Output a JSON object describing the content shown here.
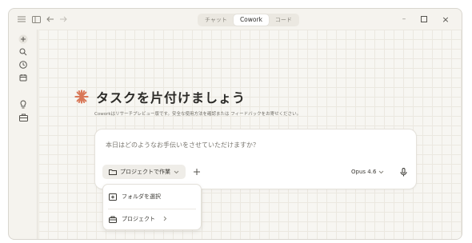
{
  "titlebar": {
    "tabs": [
      {
        "label": "チャット",
        "active": false
      },
      {
        "label": "Cowork",
        "active": true
      },
      {
        "label": "コード",
        "active": false
      }
    ],
    "minimize": "–",
    "maximize": "□",
    "close": "×"
  },
  "sidebar": {
    "icons": [
      "plus-icon",
      "search-icon",
      "clock-icon",
      "calendar-icon",
      "lightbulb-icon",
      "briefcase-icon"
    ]
  },
  "main": {
    "title": "タスクを片付けましょう",
    "subtitle": "Coworkはリサーチプレビュー版です。安全な使用方法を確認または フィードバックをお寄せください。",
    "accent_color": "#d97757"
  },
  "composer": {
    "placeholder": "本日はどのようなお手伝いをさせていただけますか？",
    "project_button": "プロジェクトで作業",
    "model": "Opus 4.6"
  },
  "menu": {
    "items": [
      {
        "label": "フォルダを選択",
        "icon": "folder-plus-icon"
      },
      {
        "label": "プロジェクト",
        "icon": "project-icon"
      }
    ]
  }
}
